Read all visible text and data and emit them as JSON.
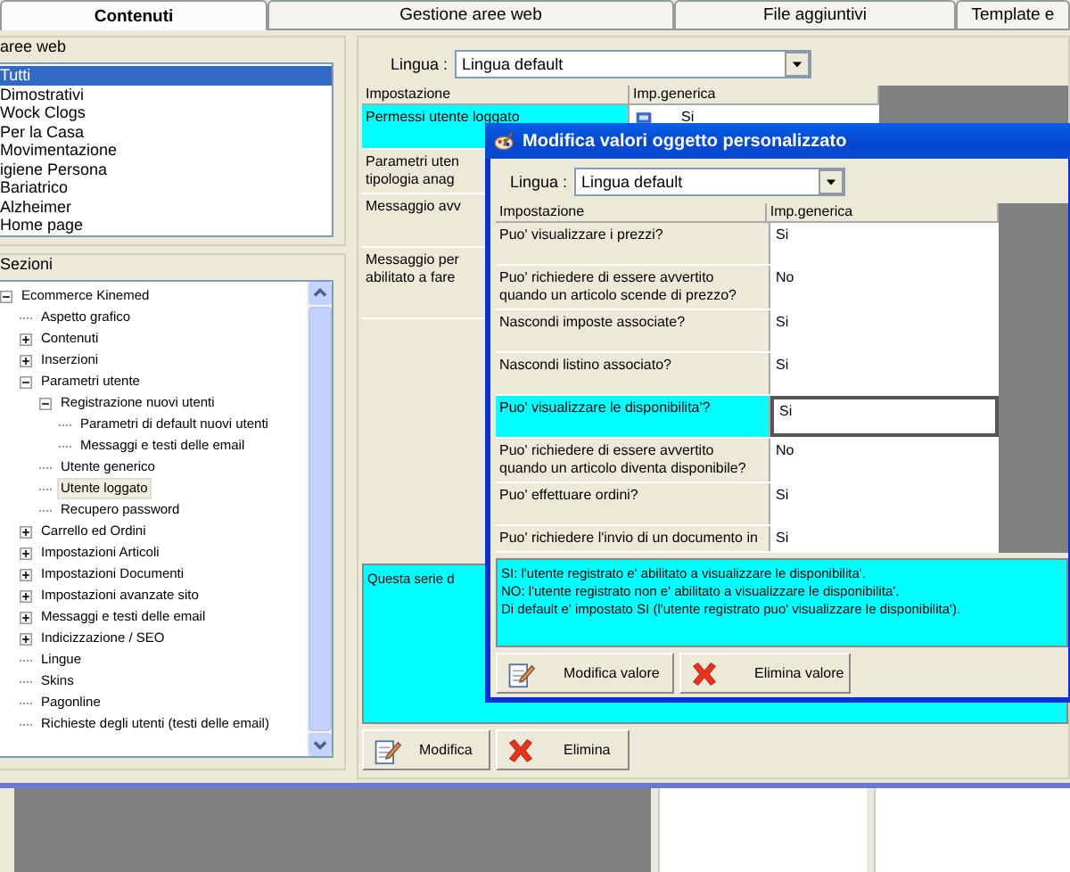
{
  "tabs": [
    {
      "label": "Contenuti",
      "selected": true
    },
    {
      "label": "Gestione aree web",
      "selected": false
    },
    {
      "label": "File aggiuntivi",
      "selected": false
    },
    {
      "label": "Template e",
      "selected": false
    }
  ],
  "aree_web": {
    "title": "aree web",
    "items": [
      {
        "label": "Tutti",
        "selected": true
      },
      {
        "label": "Dimostrativi",
        "selected": false
      },
      {
        "label": "Wock Clogs",
        "selected": false
      },
      {
        "label": "Per la Casa",
        "selected": false
      },
      {
        "label": "Movimentazione",
        "selected": false
      },
      {
        "label": "igiene Persona",
        "selected": false
      },
      {
        "label": "Bariatrico",
        "selected": false
      },
      {
        "label": "Alzheimer",
        "selected": false
      },
      {
        "label": "Home page",
        "selected": false
      }
    ]
  },
  "sezioni": {
    "title": "Sezioni",
    "tree": [
      {
        "label": "Ecommerce Kinemed",
        "expanded": true,
        "selected": false,
        "children": [
          {
            "label": "Aspetto grafico",
            "selected": false
          },
          {
            "label": "Contenuti",
            "expanded": false,
            "selected": false
          },
          {
            "label": "Inserzioni",
            "expanded": false,
            "selected": false
          },
          {
            "label": "Parametri utente",
            "expanded": true,
            "selected": false,
            "children": [
              {
                "label": "Registrazione nuovi utenti",
                "expanded": true,
                "selected": false,
                "children": [
                  {
                    "label": "Parametri di default nuovi utenti",
                    "selected": false
                  },
                  {
                    "label": "Messaggi e testi delle email",
                    "selected": false
                  }
                ]
              },
              {
                "label": "Utente generico",
                "selected": false
              },
              {
                "label": "Utente loggato",
                "selected": true
              },
              {
                "label": "Recupero password",
                "selected": false
              }
            ]
          },
          {
            "label": "Carrello ed Ordini",
            "expanded": false,
            "selected": false
          },
          {
            "label": "Impostazioni Articoli",
            "expanded": false,
            "selected": false
          },
          {
            "label": "Impostazioni Documenti",
            "expanded": false,
            "selected": false
          },
          {
            "label": "Impostazioni avanzate sito",
            "expanded": false,
            "selected": false
          },
          {
            "label": "Messaggi e testi delle email",
            "expanded": false,
            "selected": false
          },
          {
            "label": "Indicizzazione / SEO",
            "expanded": false,
            "selected": false
          },
          {
            "label": "Lingue",
            "selected": false
          },
          {
            "label": "Skins",
            "selected": false
          },
          {
            "label": "Pagonline",
            "selected": false
          },
          {
            "label": "Richieste degli utenti (testi delle email)",
            "selected": false
          }
        ]
      }
    ]
  },
  "main": {
    "lingua_label": "Lingua :",
    "lingua_value": "Lingua default",
    "columns": [
      "Impostazione",
      "Imp.generica"
    ],
    "rows": [
      {
        "lines": [
          "Permessi utente loggato"
        ],
        "value": "Si",
        "selected": true
      },
      {
        "lines": [
          "Parametri uten",
          "tipologia anag"
        ],
        "selected": false
      },
      {
        "lines": [
          "Messaggio avv"
        ],
        "selected": false
      },
      {
        "lines": [
          "Messaggio per",
          "abilitato a fare"
        ],
        "selected": false
      }
    ],
    "description": "Questa serie d",
    "buttons": [
      {
        "label": "Modifica",
        "kind": "edit"
      },
      {
        "label": "Elimina",
        "kind": "delete"
      }
    ]
  },
  "dialog": {
    "title": "Modifica valori oggetto personalizzato",
    "lingua_label": "Lingua :",
    "lingua_value": "Lingua default",
    "columns": [
      "Impostazione",
      "Imp.generica"
    ],
    "rows": [
      {
        "setting": "Puo' visualizzare i prezzi?",
        "value": "Si",
        "selected": false
      },
      {
        "setting": "Puo' richiedere di essere avvertito quando un articolo scende di prezzo?",
        "value": "No",
        "selected": false
      },
      {
        "setting": "Nascondi imposte associate?",
        "value": "Si",
        "selected": false
      },
      {
        "setting": "Nascondi listino associato?",
        "value": "Si",
        "selected": false
      },
      {
        "setting": "Puo' visualizzare le disponibilita'?",
        "value": "Si",
        "selected": true
      },
      {
        "setting": "Puo' richiedere di essere avvertito quando un articolo diventa disponibile?",
        "value": "No",
        "selected": false
      },
      {
        "setting": "Puo' effettuare ordini?",
        "value": "Si",
        "selected": false
      },
      {
        "setting": "Puo' richiedere l'invio di un documento in",
        "value": "Si",
        "selected": false
      }
    ],
    "description": [
      "SI: l'utente registrato e' abilitato a visualizzare le disponibilita'.",
      "NO: l'utente registrato non e' abilitato a visualizzare le disponibilita'.",
      "Di default e' impostato SI (l'utente registrato puo' visualizzare le disponibilita')."
    ],
    "buttons": [
      {
        "label": "Modifica valore",
        "kind": "edit"
      },
      {
        "label": "Elimina valore",
        "kind": "delete"
      }
    ]
  }
}
